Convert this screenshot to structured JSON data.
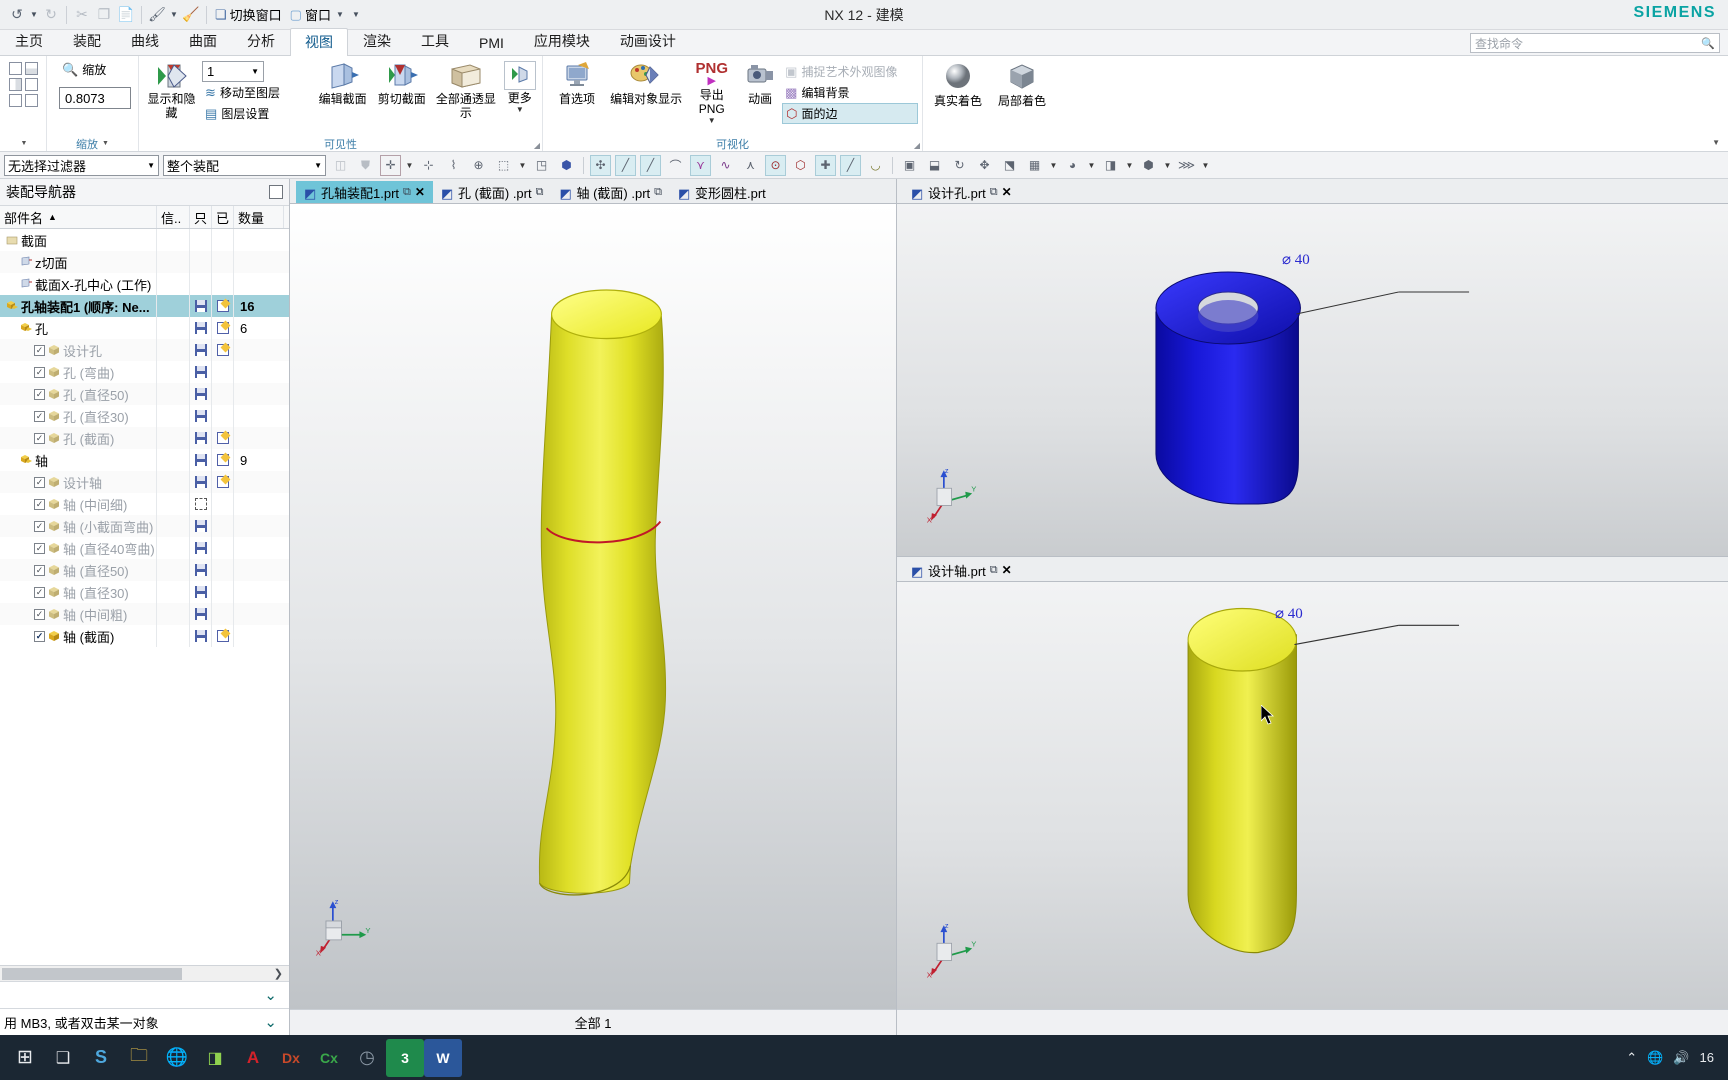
{
  "window": {
    "title": "NX 12 - 建模",
    "brand": "SIEMENS"
  },
  "quick_access": {
    "items": [
      {
        "name": "undo",
        "glyph": "↺"
      },
      {
        "name": "undo-dropdown",
        "glyph": "▾"
      },
      {
        "name": "redo",
        "glyph": "↻"
      },
      {
        "name": "cut",
        "glyph": "✂"
      },
      {
        "name": "copy",
        "glyph": "❐"
      },
      {
        "name": "paste",
        "glyph": "📋"
      },
      {
        "name": "paint",
        "glyph": "🖌"
      },
      {
        "name": "paint-dropdown",
        "glyph": "▾"
      },
      {
        "name": "eraser",
        "glyph": "🧽"
      }
    ],
    "switch_window_label": "切换窗口",
    "window_label": "窗口"
  },
  "ribbon": {
    "tabs": [
      {
        "label": "主页",
        "active": false
      },
      {
        "label": "装配",
        "active": false
      },
      {
        "label": "曲线",
        "active": false
      },
      {
        "label": "曲面",
        "active": false
      },
      {
        "label": "分析",
        "active": false
      },
      {
        "label": "视图",
        "active": true
      },
      {
        "label": "渲染",
        "active": false
      },
      {
        "label": "工具",
        "active": false
      },
      {
        "label": "PMI",
        "active": false
      },
      {
        "label": "应用模块",
        "active": false
      },
      {
        "label": "动画设计",
        "active": false
      }
    ],
    "command_search_placeholder": "查找命令",
    "groups": [
      {
        "name": "layout-group",
        "label": "",
        "items": []
      },
      {
        "name": "zoom-group",
        "label": "缩放",
        "zoom_button_label": "缩放",
        "zoom_value": "0.8073"
      },
      {
        "name": "visibility-group",
        "label": "可见性",
        "items": [
          {
            "label": "显示和隐藏",
            "type": "big"
          },
          {
            "label": "移动至图层",
            "type": "small"
          },
          {
            "label": "图层设置",
            "type": "small"
          },
          {
            "label": "编辑截面",
            "type": "big"
          },
          {
            "label": "剪切截面",
            "type": "big"
          },
          {
            "label": "全部通透显示",
            "type": "big"
          },
          {
            "label": "更多",
            "type": "big"
          }
        ],
        "layer_value": "1"
      },
      {
        "name": "visualization-group",
        "label": "可视化",
        "items": [
          {
            "label": "首选项",
            "type": "big"
          },
          {
            "label": "编辑对象显示",
            "type": "big"
          },
          {
            "label": "导出 PNG",
            "type": "big"
          },
          {
            "label": "动画",
            "type": "big"
          },
          {
            "label": "捕捉艺术外观图像",
            "type": "small",
            "disabled": true
          },
          {
            "label": "编辑背景",
            "type": "small"
          },
          {
            "label": "面的边",
            "type": "small",
            "highlighted": true
          }
        ]
      },
      {
        "name": "style-group",
        "label": "",
        "items": [
          {
            "label": "真实着色",
            "type": "big"
          },
          {
            "label": "局部着色",
            "type": "big"
          }
        ]
      }
    ]
  },
  "selection_bar": {
    "filter_value": "无选择过滤器",
    "scope_value": "整个装配"
  },
  "navigator": {
    "title": "装配导航器",
    "columns": [
      "部件名",
      "信..",
      "只",
      "已",
      "数量"
    ],
    "sort_indicator": "▲",
    "rows": [
      {
        "label": "截面",
        "indent": 0,
        "checkbox": null,
        "icon": "section",
        "dim": false,
        "bold": false,
        "save": false,
        "edit": false,
        "qty": ""
      },
      {
        "label": "z切面",
        "indent": 1,
        "checkbox": null,
        "icon": "plane",
        "dim": false,
        "bold": false,
        "save": false,
        "edit": false,
        "qty": ""
      },
      {
        "label": "截面X-孔中心 (工作)",
        "indent": 1,
        "checkbox": null,
        "icon": "plane",
        "dim": false,
        "bold": false,
        "save": false,
        "edit": false,
        "qty": ""
      },
      {
        "label": "孔轴装配1 (顺序: Ne...",
        "indent": 0,
        "checkbox": null,
        "icon": "asm",
        "dim": false,
        "bold": true,
        "selected": true,
        "save": true,
        "edit": true,
        "qty": "16"
      },
      {
        "label": "孔",
        "indent": 1,
        "checkbox": null,
        "icon": "asm",
        "dim": false,
        "bold": false,
        "save": true,
        "edit": true,
        "qty": "6"
      },
      {
        "label": "设计孔",
        "indent": 2,
        "checkbox": "on",
        "icon": "part",
        "dim": true,
        "bold": false,
        "save": true,
        "edit": true,
        "qty": ""
      },
      {
        "label": "孔 (弯曲)",
        "indent": 2,
        "checkbox": "on",
        "icon": "part",
        "dim": true,
        "bold": false,
        "save": true,
        "edit": false,
        "qty": ""
      },
      {
        "label": "孔 (直径50)",
        "indent": 2,
        "checkbox": "on",
        "icon": "part",
        "dim": true,
        "bold": false,
        "save": true,
        "edit": false,
        "qty": ""
      },
      {
        "label": "孔 (直径30)",
        "indent": 2,
        "checkbox": "on",
        "icon": "part",
        "dim": true,
        "bold": false,
        "save": true,
        "edit": false,
        "qty": ""
      },
      {
        "label": "孔 (截面)",
        "indent": 2,
        "checkbox": "on",
        "icon": "part",
        "dim": true,
        "bold": false,
        "save": true,
        "edit": true,
        "qty": ""
      },
      {
        "label": "轴",
        "indent": 1,
        "checkbox": null,
        "icon": "asm",
        "dim": false,
        "bold": false,
        "save": true,
        "edit": true,
        "qty": "9"
      },
      {
        "label": "设计轴",
        "indent": 2,
        "checkbox": "on",
        "icon": "part",
        "dim": true,
        "bold": false,
        "save": true,
        "edit": true,
        "qty": ""
      },
      {
        "label": "轴 (中间细)",
        "indent": 2,
        "checkbox": "on",
        "icon": "part",
        "dim": true,
        "bold": false,
        "save": "dashed",
        "edit": false,
        "qty": ""
      },
      {
        "label": "轴 (小截面弯曲)",
        "indent": 2,
        "checkbox": "on",
        "icon": "part",
        "dim": true,
        "bold": false,
        "save": true,
        "edit": false,
        "qty": ""
      },
      {
        "label": "轴 (直径40弯曲)",
        "indent": 2,
        "checkbox": "on",
        "icon": "part",
        "dim": true,
        "bold": false,
        "save": true,
        "edit": false,
        "qty": ""
      },
      {
        "label": "轴 (直径50)",
        "indent": 2,
        "checkbox": "on",
        "icon": "part",
        "dim": true,
        "bold": false,
        "save": true,
        "edit": false,
        "qty": ""
      },
      {
        "label": "轴 (直径30)",
        "indent": 2,
        "checkbox": "on",
        "icon": "part",
        "dim": true,
        "bold": false,
        "save": true,
        "edit": false,
        "qty": ""
      },
      {
        "label": "轴 (中间粗)",
        "indent": 2,
        "checkbox": "on",
        "icon": "part",
        "dim": true,
        "bold": false,
        "save": true,
        "edit": false,
        "qty": ""
      },
      {
        "label": "轴 (截面)",
        "indent": 2,
        "checkbox": "on-dark",
        "icon": "part",
        "dim": false,
        "bold": false,
        "save": true,
        "edit": true,
        "qty": ""
      }
    ]
  },
  "document_tabs": {
    "left": [
      {
        "label": "孔轴装配1.prt",
        "active": true,
        "closable": true
      },
      {
        "label": "孔 (截面) .prt",
        "active": false,
        "closable": false
      },
      {
        "label": "轴 (截面) .prt",
        "active": false,
        "closable": false
      },
      {
        "label": "变形圆柱.prt",
        "active": false,
        "closable": false
      }
    ],
    "right_top": [
      {
        "label": "设计孔.prt",
        "active": true,
        "closable": true
      }
    ],
    "right_bottom": [
      {
        "label": "设计轴.prt",
        "active": true,
        "closable": true
      }
    ]
  },
  "viewports": {
    "main": {
      "model": "deformed-shaft",
      "model_color": "#e8e832",
      "section_curve_color": "#d02030",
      "csys_labels": {
        "x": "X",
        "y": "Y",
        "z": "Z"
      }
    },
    "top_right": {
      "model": "hole-cylinder",
      "model_color": "#1414dc",
      "dimension_label": "⌀ 40",
      "csys_labels": {
        "x": "X",
        "y": "Y",
        "z": "Z"
      }
    },
    "bottom_right": {
      "model": "shaft-cylinder",
      "model_color": "#e8e832",
      "dimension_label": "⌀ 40",
      "csys_labels": {
        "x": "X",
        "y": "Y",
        "z": "Z"
      }
    }
  },
  "status_bar": {
    "left_message": "用 MB3, 或者双击某一对象",
    "center_message": "全部 1"
  },
  "taskbar": {
    "items": [
      {
        "name": "start-button",
        "glyph": "⊞",
        "color": "#e8eaed"
      },
      {
        "name": "task-view-button",
        "glyph": "❑",
        "color": "#e8eaed"
      },
      {
        "name": "app-browser-s",
        "glyph": "S",
        "color": "#4ea8de"
      },
      {
        "name": "app-folder",
        "glyph": "📁",
        "color": "#e8c14a"
      },
      {
        "name": "app-browser-globe",
        "glyph": "🌐",
        "color": "#4cc2a8"
      },
      {
        "name": "app-nx",
        "glyph": "NX",
        "color": "#8fd14f"
      },
      {
        "name": "app-acrobat",
        "glyph": "A",
        "color": "#d4222a"
      },
      {
        "name": "app-dx",
        "glyph": "Dx",
        "color": "#c8492a"
      },
      {
        "name": "app-cx",
        "glyph": "Cx",
        "color": "#3aa84a"
      },
      {
        "name": "app-clock",
        "glyph": "◷",
        "color": "#7a8794"
      },
      {
        "name": "app-excel",
        "glyph": "3",
        "color": "#1f8a4c"
      },
      {
        "name": "app-word",
        "glyph": "W",
        "color": "#2b579a"
      }
    ],
    "tray": {
      "chevron": "⌃",
      "network": "🌐",
      "sound": "🔊",
      "count": "16"
    }
  }
}
